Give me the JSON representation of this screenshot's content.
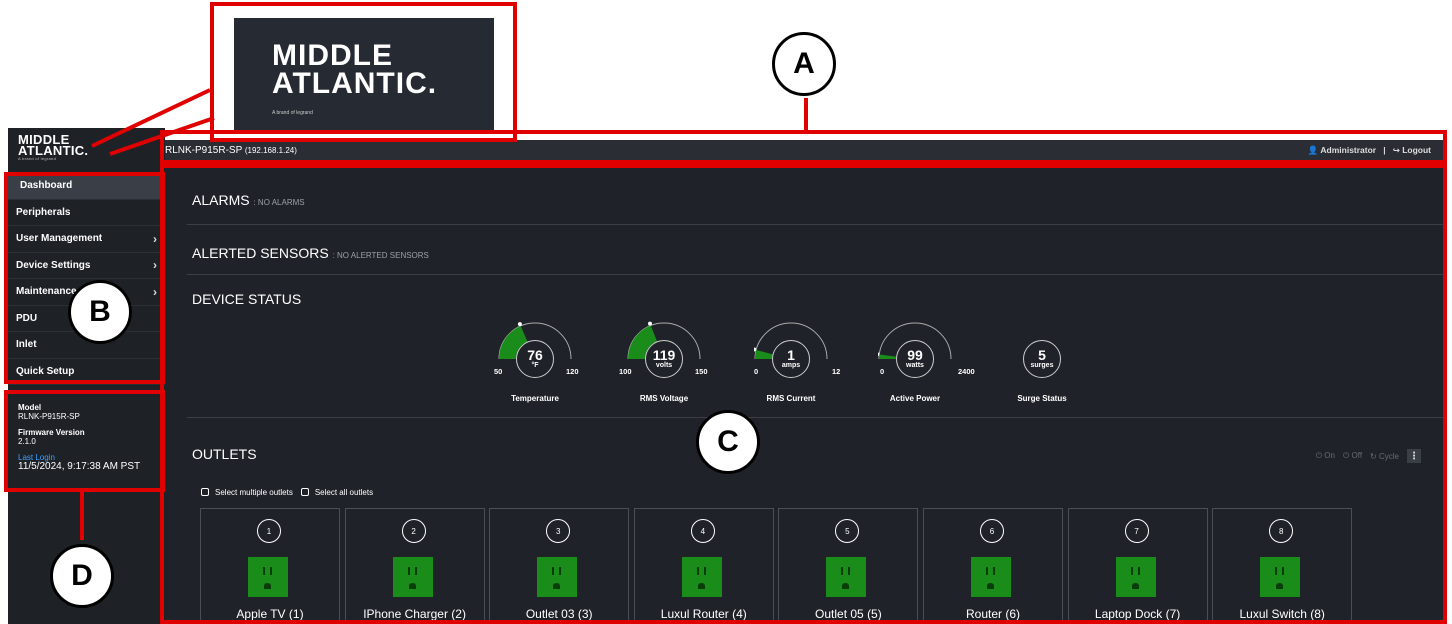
{
  "logo": {
    "line1": "MIDDLE",
    "line2": "ATLANTIC.",
    "tagline": "A brand of legrand"
  },
  "topbar": {
    "device": "RLNK-P915R-SP",
    "ip": "(192.168.1.24)",
    "user": "Administrator",
    "separator": "|",
    "logout": "Logout"
  },
  "sidebar": {
    "items": [
      {
        "label": "Dashboard",
        "chevron": ""
      },
      {
        "label": "Peripherals",
        "chevron": ""
      },
      {
        "label": "User Management",
        "chevron": "›"
      },
      {
        "label": "Device Settings",
        "chevron": "›"
      },
      {
        "label": "Maintenance",
        "chevron": "›"
      },
      {
        "label": "PDU",
        "chevron": ""
      },
      {
        "label": "Inlet",
        "chevron": ""
      },
      {
        "label": "Quick Setup",
        "chevron": ""
      }
    ],
    "info": {
      "model_label": "Model",
      "model": "RLNK-P915R-SP",
      "fw_label": "Firmware Version",
      "fw": "2.1.0",
      "login_label": "Last Login",
      "login": "11/5/2024, 9:17:38 AM PST"
    }
  },
  "alarms": {
    "title": "ALARMS",
    "sub": ": NO ALARMS"
  },
  "sensors": {
    "title": "ALERTED SENSORS",
    "sub": ": NO ALERTED SENSORS"
  },
  "status": {
    "title": "DEVICE STATUS",
    "gauges": [
      {
        "value": "76",
        "unit": "°F",
        "min": "50",
        "max": "120",
        "label": "Temperature",
        "fraction": 0.37
      },
      {
        "value": "119",
        "unit": "volts",
        "min": "100",
        "max": "150",
        "label": "RMS Voltage",
        "fraction": 0.38
      },
      {
        "value": "1",
        "unit": "amps",
        "min": "0",
        "max": "12",
        "label": "RMS Current",
        "fraction": 0.08
      },
      {
        "value": "99",
        "unit": "watts",
        "min": "0",
        "max": "2400",
        "label": "Active Power",
        "fraction": 0.04
      },
      {
        "value": "5",
        "unit": "surges",
        "label": "Surge Status"
      }
    ]
  },
  "outlets": {
    "title": "OUTLETS",
    "on": "On",
    "off": "Off",
    "cycle": "Cycle",
    "kebab": "⋮",
    "select_multiple": "Select multiple outlets",
    "select_all": "Select all outlets",
    "items": [
      {
        "num": "1",
        "name": "Apple TV (1)"
      },
      {
        "num": "2",
        "name": "IPhone Charger (2)"
      },
      {
        "num": "3",
        "name": "Outlet 03 (3)"
      },
      {
        "num": "4",
        "name": "Luxul Router (4)"
      },
      {
        "num": "5",
        "name": "Outlet 05 (5)"
      },
      {
        "num": "6",
        "name": "Router (6)"
      },
      {
        "num": "7",
        "name": "Laptop Dock (7)"
      },
      {
        "num": "8",
        "name": "Luxul Switch (8)"
      }
    ]
  },
  "callouts": {
    "a": "A",
    "b": "B",
    "c": "C",
    "d": "D"
  },
  "colors": {
    "accent_red": "#e00000",
    "gauge_green": "#1a8c1a",
    "panel_bg": "#1f2329"
  }
}
